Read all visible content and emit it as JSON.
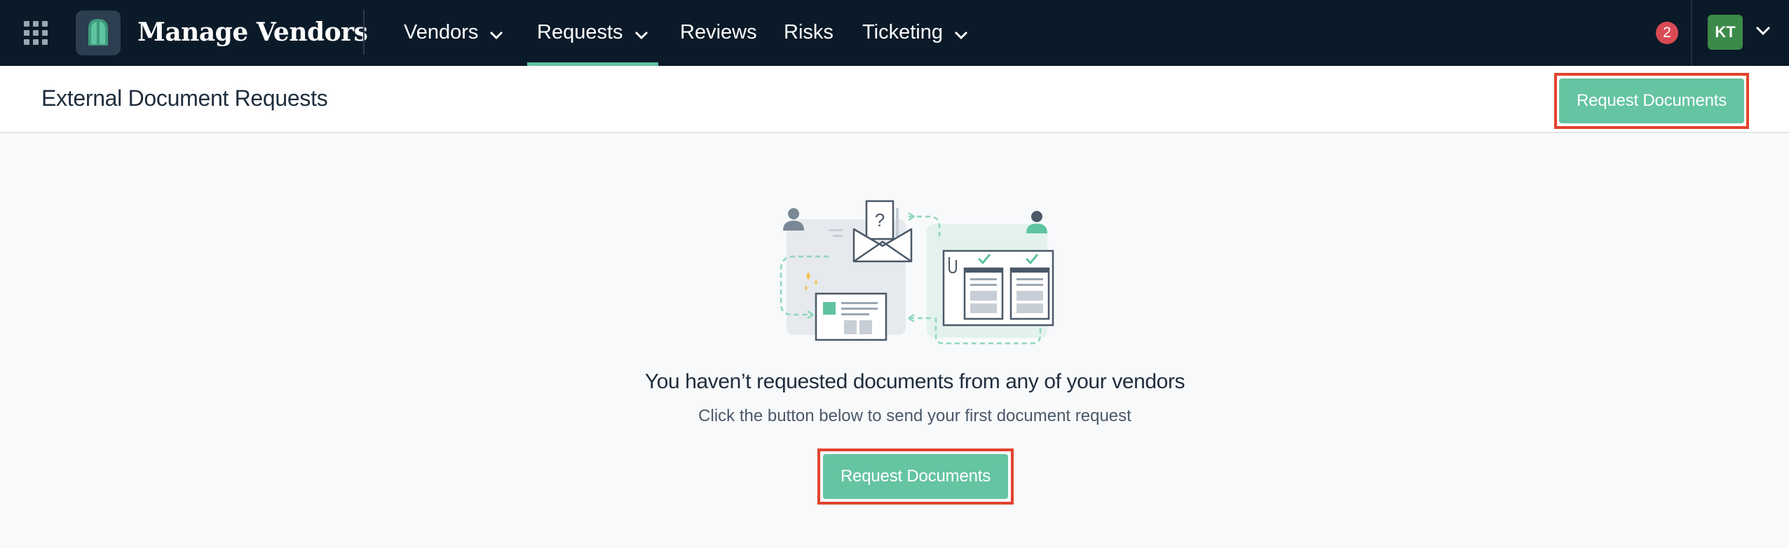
{
  "app": {
    "title": "Manage Vendors",
    "notification_count": "2",
    "user_initials": "KT"
  },
  "nav": {
    "vendors": "Vendors",
    "requests": "Requests",
    "reviews": "Reviews",
    "risks": "Risks",
    "ticketing": "Ticketing"
  },
  "page": {
    "title": "External Document Requests",
    "request_button": "Request Documents"
  },
  "empty_state": {
    "title": "You haven’t requested documents from any of your vendors",
    "subtitle": "Click the button below to send your first document request",
    "button": "Request Documents"
  },
  "colors": {
    "nav_bg": "#0b1a28",
    "accent": "#65c4a1",
    "highlight": "#e2432d",
    "badge": "#d94a55",
    "avatar": "#3c8a4a"
  },
  "icons": [
    "app-grid-icon",
    "app-logo-icon",
    "chevron-down-icon",
    "document-request-illustration"
  ]
}
